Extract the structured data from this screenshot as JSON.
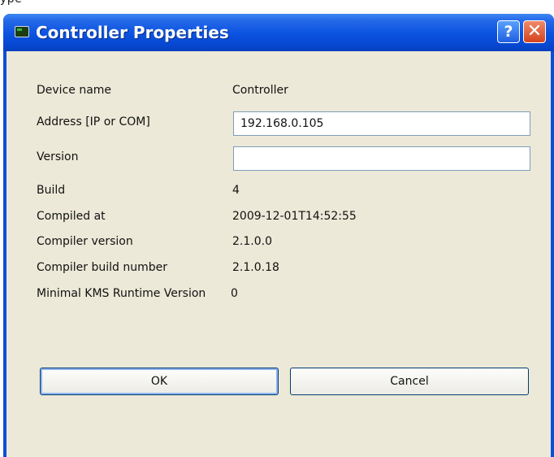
{
  "top_partial_text": "ype",
  "window": {
    "title": "Controller Properties",
    "help_glyph": "?",
    "close_glyph": "✕",
    "icon": "controller-app-icon"
  },
  "properties": {
    "device_name": {
      "label": "Device name",
      "value": "Controller"
    },
    "address": {
      "label": "Address [IP or COM]",
      "value": "192.168.0.105",
      "placeholder": ""
    },
    "version": {
      "label": "Version",
      "value": "",
      "placeholder": ""
    },
    "build": {
      "label": "Build",
      "value": "4"
    },
    "compiled_at": {
      "label": "Compiled at",
      "value": "2009-12-01T14:52:55"
    },
    "compiler_version": {
      "label": "Compiler version",
      "value": "2.1.0.0"
    },
    "compiler_build_number": {
      "label": "Compiler build number",
      "value": "2.1.0.18"
    },
    "minimal_kms_runtime": {
      "label": "Minimal KMS Runtime Version",
      "value": "0"
    }
  },
  "buttons": {
    "ok": "OK",
    "cancel": "Cancel"
  },
  "colors": {
    "titlebar": "#0a52e0",
    "client_bg": "#ece9d8",
    "close_button": "#d4421c",
    "button_border": "#003c74"
  }
}
